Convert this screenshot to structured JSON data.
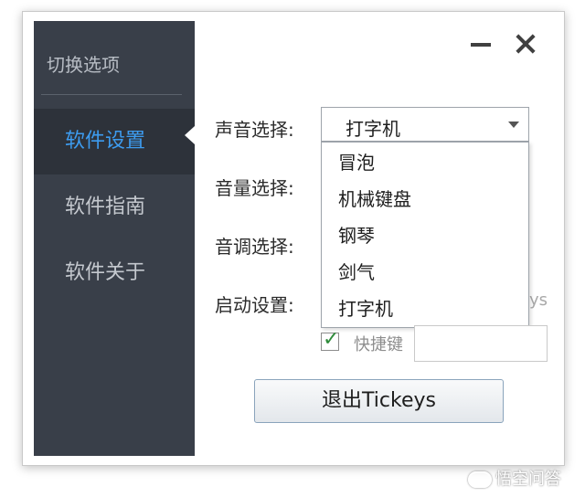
{
  "sidebar": {
    "title": "切换选项",
    "items": [
      {
        "label": "软件设置",
        "active": true
      },
      {
        "label": "软件指南",
        "active": false
      },
      {
        "label": "软件关于",
        "active": false
      }
    ]
  },
  "settings": {
    "sound_label": "声音选择:",
    "volume_label": "音量选择:",
    "pitch_label": "音调选择:",
    "startup_label": "启动设置:",
    "sound_select": {
      "value": "打字机",
      "options": [
        "冒泡",
        "机械键盘",
        "钢琴",
        "剑气",
        "打字机"
      ]
    },
    "obscured_text": "ys",
    "hotkey_label": "快捷键",
    "hotkey_checked": true
  },
  "exit_button_label": "退出Tickeys",
  "watermark": "悟空问答",
  "colors": {
    "sidebar_bg": "#393f49",
    "active_item_bg": "#2d323a",
    "active_item_text": "#3d9cf0"
  }
}
